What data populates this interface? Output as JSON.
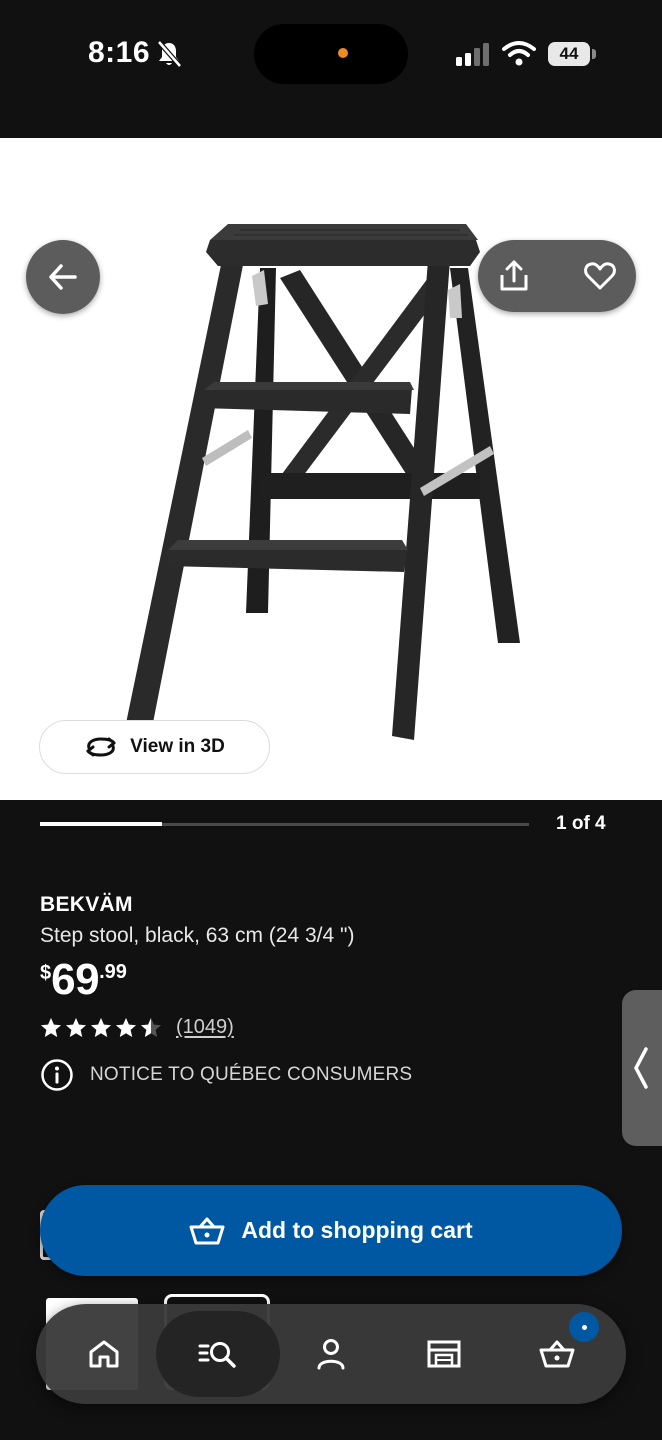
{
  "status_bar": {
    "time": "8:16",
    "battery": "44"
  },
  "gallery": {
    "view_3d_label": "View in 3D",
    "page_indicator": "1 of 4",
    "current_page": 1,
    "total_pages": 4
  },
  "product": {
    "brand": "BEKVÄM",
    "description": "Step stool, black, 63 cm (24 3/4 \")",
    "price": {
      "currency": "$",
      "integer": "69",
      "decimal": ".99"
    },
    "rating": 4.5,
    "rating_max": 5,
    "reviews": "(1049)",
    "notice": "NOTICE TO QUÉBEC CONSUMERS"
  },
  "cart_button": {
    "label": "Add to shopping cart"
  },
  "bottom_nav": {
    "items": [
      "home-icon",
      "search-icon",
      "account-icon",
      "store-icon",
      "cart-icon"
    ],
    "active": "search-icon"
  },
  "colors": {
    "background": "#111111",
    "accent": "#0058a3",
    "image_bg": "#ffffff"
  }
}
